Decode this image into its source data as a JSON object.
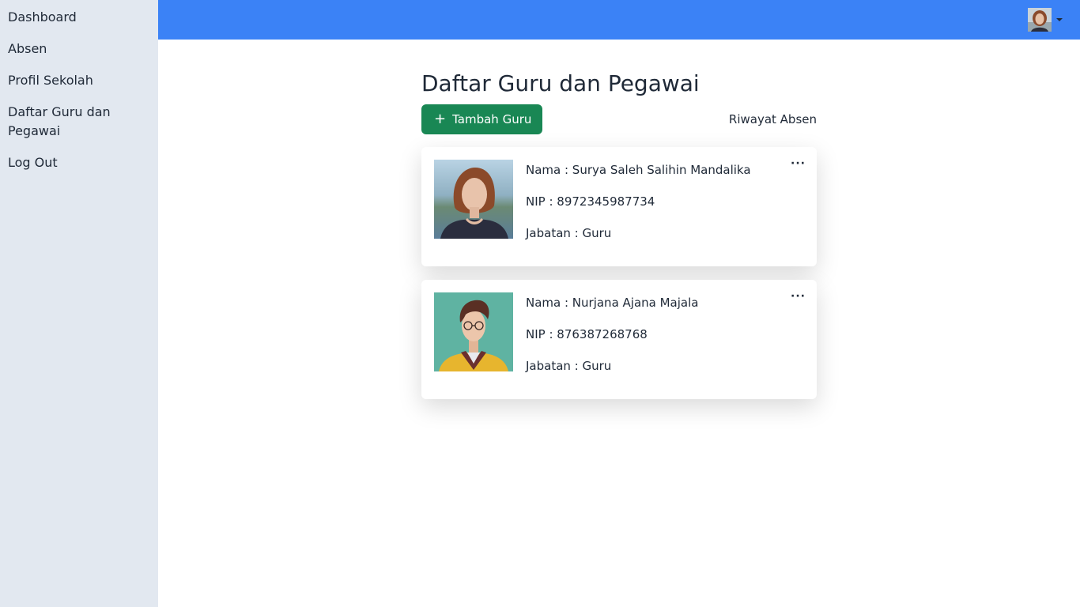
{
  "sidebar": {
    "items": [
      {
        "label": "Dashboard"
      },
      {
        "label": "Absen"
      },
      {
        "label": "Profil Sekolah"
      },
      {
        "label": "Daftar Guru dan Pegawai"
      },
      {
        "label": "Log Out"
      }
    ]
  },
  "header": {
    "accent_color": "#3b82f6",
    "avatar_icon": "user-avatar"
  },
  "main": {
    "title": "Daftar Guru dan Pegawai",
    "add_button": {
      "icon": "plus-icon",
      "label": "Tambah Guru"
    },
    "history_link": "Riwayat Absen",
    "cards": [
      {
        "nama": "Nama : Surya Saleh Salihin Mandalika",
        "nip": "NIP : 8972345987734",
        "jabatan": "Jabatan : Guru",
        "more": "···"
      },
      {
        "nama": "Nama : Nurjana Ajana Majala",
        "nip": "NIP : 876387268768",
        "jabatan": "Jabatan : Guru",
        "more": "···"
      }
    ]
  },
  "colors": {
    "sidebar_bg": "#e2e8f0",
    "button_green": "#198754"
  }
}
